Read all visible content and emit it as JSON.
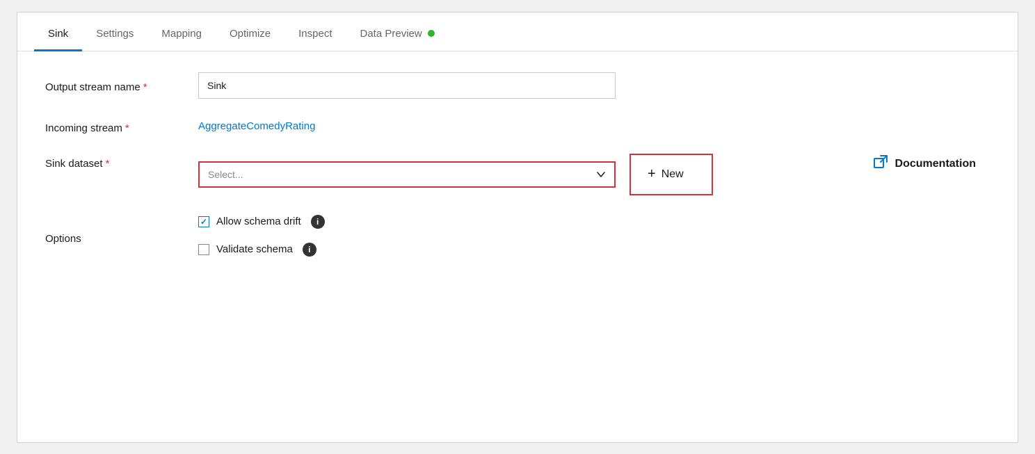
{
  "tabs": [
    {
      "id": "sink",
      "label": "Sink",
      "active": true
    },
    {
      "id": "settings",
      "label": "Settings",
      "active": false
    },
    {
      "id": "mapping",
      "label": "Mapping",
      "active": false
    },
    {
      "id": "optimize",
      "label": "Optimize",
      "active": false
    },
    {
      "id": "inspect",
      "label": "Inspect",
      "active": false
    },
    {
      "id": "data-preview",
      "label": "Data Preview",
      "active": false
    }
  ],
  "form": {
    "output_stream_label": "Output stream name",
    "output_stream_required": "*",
    "output_stream_value": "Sink",
    "incoming_stream_label": "Incoming stream",
    "incoming_stream_required": "*",
    "incoming_stream_value": "AggregateComedyRating",
    "sink_dataset_label": "Sink dataset",
    "sink_dataset_required": "*",
    "sink_dataset_placeholder": "Select...",
    "options_label": "Options",
    "allow_schema_drift_label": "Allow schema drift",
    "validate_schema_label": "Validate schema",
    "new_button_plus": "+",
    "new_button_label": "New"
  },
  "documentation": {
    "label": "Documentation",
    "icon": "⧉"
  },
  "colors": {
    "accent_blue": "#0078d4",
    "required_red": "#d13438",
    "tab_active_underline": "#0078d4",
    "green_dot": "#2db52d"
  }
}
